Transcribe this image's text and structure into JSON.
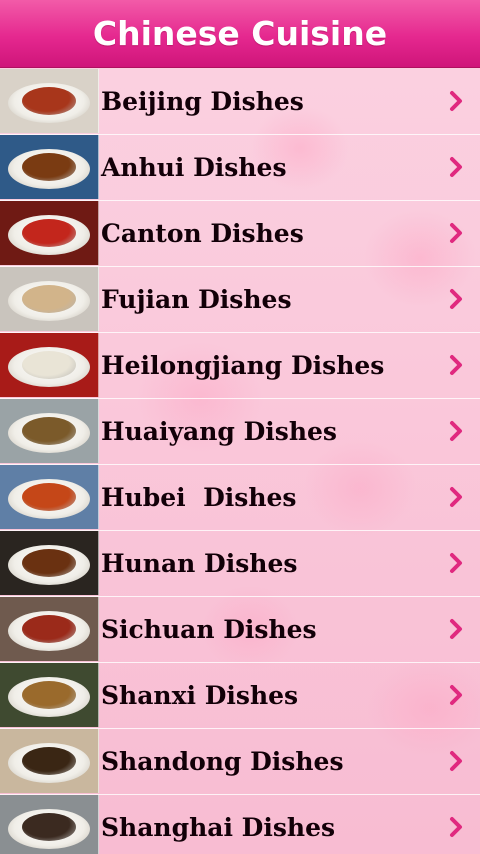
{
  "header": {
    "title": "Chinese Cuisine"
  },
  "list": {
    "items": [
      {
        "label": "Beijing Dishes",
        "food_color": "#a8361b",
        "bg_color": "#d9d2c8"
      },
      {
        "label": "Anhui Dishes",
        "food_color": "#7a3b12",
        "bg_color": "#2f5a88"
      },
      {
        "label": "Canton Dishes",
        "food_color": "#c3261c",
        "bg_color": "#6f1a14"
      },
      {
        "label": "Fujian Dishes",
        "food_color": "#d2b48a",
        "bg_color": "#c9c4bd"
      },
      {
        "label": "Heilongjiang Dishes",
        "food_color": "#e9e4d6",
        "bg_color": "#a81b18"
      },
      {
        "label": "Huaiyang Dishes",
        "food_color": "#7b5a2a",
        "bg_color": "#9aa3a6"
      },
      {
        "label": "Hubei  Dishes",
        "food_color": "#c54718",
        "bg_color": "#5f7fa6"
      },
      {
        "label": "Hunan Dishes",
        "food_color": "#6a3111",
        "bg_color": "#2a2520"
      },
      {
        "label": "Sichuan Dishes",
        "food_color": "#9b2a1a",
        "bg_color": "#6f5a4e"
      },
      {
        "label": "Shanxi Dishes",
        "food_color": "#9a6a2c",
        "bg_color": "#3f4a30"
      },
      {
        "label": "Shandong Dishes",
        "food_color": "#3a2614",
        "bg_color": "#c9b79e"
      },
      {
        "label": "Shanghai Dishes",
        "food_color": "#3b2a20",
        "bg_color": "#8a8f92"
      }
    ]
  },
  "colors": {
    "header_top": "#f25ba8",
    "header_bottom": "#cf157a",
    "chevron": "#e0297f",
    "list_bg": "#f8bcd2"
  },
  "icons": {
    "chevron": "chevron-right-icon"
  }
}
